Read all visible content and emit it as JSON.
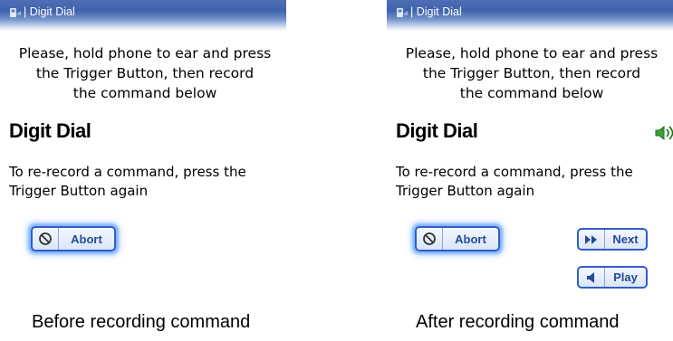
{
  "screens": {
    "before": {
      "title": "Digit Dial",
      "instruction": [
        "Please, hold phone to ear and press",
        "the Trigger Button, then record",
        "the command below"
      ],
      "command_title": "Digit Dial",
      "hint": [
        "To re-record a command, press the",
        "Trigger Button again"
      ],
      "abort_label": "Abort"
    },
    "after": {
      "title": "Digit Dial",
      "instruction": [
        "Please, hold phone to ear and press",
        "the Trigger Button, then record",
        "the command below"
      ],
      "command_title": "Digit Dial",
      "hint": [
        "To re-record a command, press the",
        "Trigger Button again"
      ],
      "abort_label": "Abort",
      "next_label": "Next",
      "play_label": "Play"
    }
  },
  "captions": {
    "before": "Before recording command",
    "after": "After recording command"
  },
  "icons": {
    "title_icon": "phone-icon",
    "abort_icon": "prohibited-icon",
    "next_icon": "fast-forward-icon",
    "play_icon": "speaker-icon",
    "volume_icon": "speaker-volume-icon"
  },
  "colors": {
    "titlebar": "#3f63ad",
    "button_border": "#2f5ec8",
    "button_text": "#244a9c",
    "speaker_green": "#3aa23a"
  }
}
